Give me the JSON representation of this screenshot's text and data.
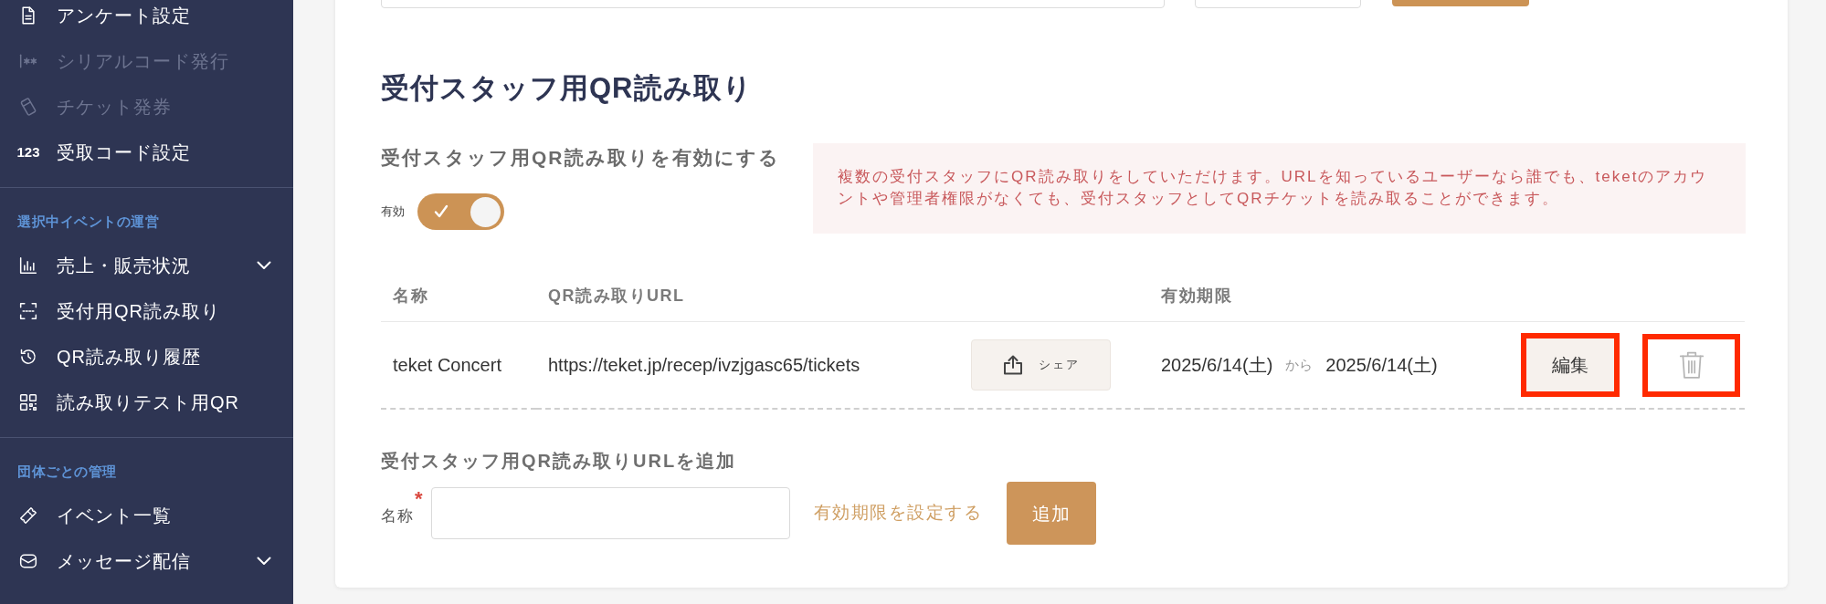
{
  "cut_off_controls": [
    {
      "kind": "field"
    },
    {
      "kind": "field"
    },
    {
      "kind": "button"
    }
  ],
  "sidebar": {
    "top_items": [
      {
        "label": "アンケート設定",
        "disabled": false
      },
      {
        "label": "シリアルコード発行",
        "disabled": true
      },
      {
        "label": "チケット発券",
        "disabled": true
      },
      {
        "label": "受取コード設定",
        "disabled": false,
        "glyph": "123"
      }
    ],
    "sections": [
      {
        "title": "選択中イベントの運営",
        "items": [
          {
            "label": "売上・販売状況",
            "kind": "submenu",
            "expanded": false,
            "disabled": false
          },
          {
            "label": "受付用QR読み取り",
            "kind": "link",
            "disabled": false
          },
          {
            "label": "QR読み取り履歴",
            "kind": "link",
            "disabled": false
          },
          {
            "label": "読み取りテスト用QR",
            "kind": "link",
            "disabled": false
          }
        ]
      },
      {
        "title": "団体ごとの管理",
        "items": [
          {
            "label": "イベント一覧",
            "kind": "link",
            "disabled": false
          },
          {
            "label": "メッセージ配信",
            "kind": "submenu",
            "expanded": false,
            "disabled": false
          }
        ]
      }
    ]
  },
  "qr_reception": {
    "heading": "受付スタッフ用QR読み取り",
    "enable_label": "受付スタッフ用QR読み取りを有効にする",
    "toggle": {
      "label": "有効",
      "on": true
    },
    "notice": "複数の受付スタッフにQR読み取りをしていただけます。URLを知っているユーザーなら誰でも、teketのアカウントや管理者権限がなくても、受付スタッフとしてQRチケットを読み取ることができます。",
    "table": {
      "columns": [
        "名称",
        "QR読み取りURL",
        "有効期限"
      ],
      "rows": [
        {
          "name": "teket Concert",
          "url": "https://teket.jp/recep/ivzjgasc65/tickets",
          "share_label": "シェア",
          "valid_from": "2025/6/14(土)",
          "range_word": "から",
          "valid_to": "2025/6/14(土)",
          "actions": [
            {
              "kind": "edit",
              "label": "編集",
              "highlighted": true
            },
            {
              "kind": "delete",
              "highlighted": true
            }
          ]
        }
      ]
    },
    "add_form": {
      "title": "受付スタッフ用QR読み取りURLを追加",
      "name_label": "名称",
      "required_mark": "*",
      "expiry_link": "有効期限を設定する",
      "submit": "追加"
    }
  }
}
